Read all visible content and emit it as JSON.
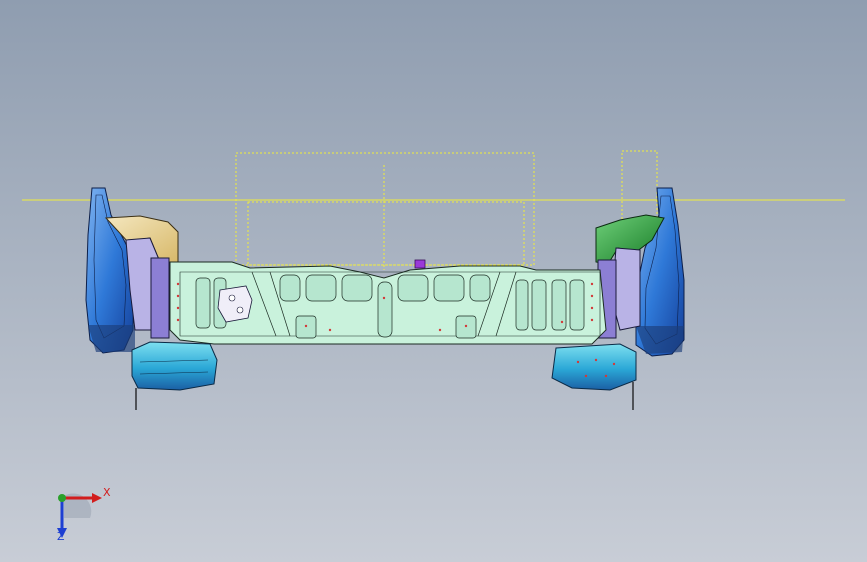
{
  "viewport": {
    "background_top": "#8f9db0",
    "background_bottom": "#c8cdd6",
    "description_icon": "cad-3d-viewport"
  },
  "model": {
    "name_icon": "car-rear-floor-panel-assembly-icon",
    "colors": {
      "center_panel": "#c9f2dc",
      "side_blue": "#2f79d8",
      "side_cyan": "#3fb3dd",
      "bracket_tan": "#e9d39a",
      "bracket_green": "#1f9a2e",
      "pad_purple": "#9a3ad8",
      "sketch_yellow": "#f2ee3a"
    }
  },
  "triad": {
    "x_label": "X",
    "z_label": "Z",
    "x_color": "#d21d1d",
    "y_color": "#2aa02a",
    "z_color": "#1d3fd2"
  }
}
